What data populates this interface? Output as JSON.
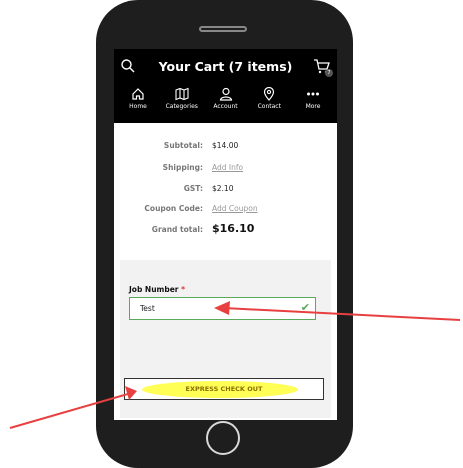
{
  "header": {
    "title": "Your Cart (7 items)",
    "cart_badge": "7"
  },
  "nav": {
    "items": [
      {
        "label": "Home",
        "icon": "home-icon"
      },
      {
        "label": "Categories",
        "icon": "map-icon"
      },
      {
        "label": "Account",
        "icon": "account-icon"
      },
      {
        "label": "Contact",
        "icon": "location-pin-icon"
      },
      {
        "label": "More",
        "icon": "more-dots-icon"
      }
    ]
  },
  "summary": {
    "subtotal_label": "Subtotal:",
    "subtotal_value": "$14.00",
    "shipping_label": "Shipping:",
    "shipping_value": "Add Info",
    "gst_label": "GST:",
    "gst_value": "$2.10",
    "coupon_label": "Coupon Code:",
    "coupon_value": "Add Coupon",
    "grand_label": "Grand total:",
    "grand_value": "$16.10"
  },
  "job": {
    "label": "Job Number",
    "required_mark": "*",
    "value": "Test"
  },
  "checkout": {
    "button_label": "EXPRESS CHECK OUT"
  },
  "colors": {
    "appbar": "#000000",
    "valid_border": "#5aa85a",
    "highlight": "#ffff55",
    "arrow": "#e84040"
  }
}
